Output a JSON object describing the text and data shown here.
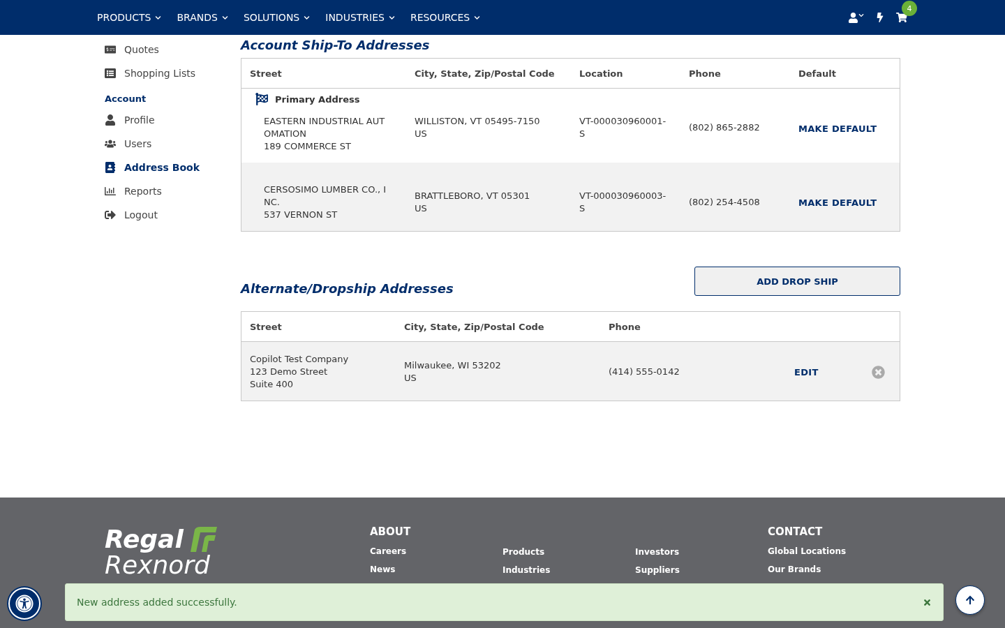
{
  "nav": {
    "menus": [
      "PRODUCTS",
      "BRANDS",
      "SOLUTIONS",
      "INDUSTRIES",
      "RESOURCES"
    ],
    "cart_count": "4"
  },
  "sidebar": {
    "groups": [
      {
        "items": [
          {
            "label": "Quotes",
            "selected": false
          },
          {
            "label": "Shopping Lists",
            "selected": false
          }
        ]
      },
      {
        "heading": "Account",
        "items": [
          {
            "label": "Profile",
            "selected": false
          },
          {
            "label": "Users",
            "selected": false
          },
          {
            "label": "Address Book",
            "selected": true
          },
          {
            "label": "Reports",
            "selected": false
          },
          {
            "label": "Logout",
            "selected": false
          }
        ]
      }
    ]
  },
  "ship_to": {
    "title": "Account Ship-To Addresses",
    "columns": [
      "Street",
      "City, State, Zip/Postal Code",
      "Location",
      "Phone",
      "Default"
    ],
    "rows": [
      {
        "primary": true,
        "primary_label": "Primary Address",
        "street": [
          "EASTERN INDUSTRIAL AUT",
          "OMATION",
          "189 COMMERCE ST"
        ],
        "city": [
          "WILLISTON, VT 05495-7150",
          "US"
        ],
        "location": [
          "VT-000030960001-",
          "S"
        ],
        "phone": "(802) 865-2882",
        "action": "MAKE DEFAULT"
      },
      {
        "primary": false,
        "street": [
          "CERSOSIMO LUMBER CO., I",
          "NC.",
          "537 VERNON ST"
        ],
        "city": [
          "BRATTLEBORO, VT 05301",
          "US"
        ],
        "location": [
          "VT-000030960003-",
          "S"
        ],
        "phone": "(802) 254-4508",
        "action": "MAKE DEFAULT"
      }
    ]
  },
  "dropship": {
    "title": "Alternate/Dropship Addresses",
    "add_button": "ADD DROP SHIP",
    "columns": [
      "Street",
      "City, State, Zip/Postal Code",
      "Phone"
    ],
    "rows": [
      {
        "street": [
          "Copilot Test Company",
          "123 Demo Street",
          "Suite 400"
        ],
        "city": [
          "Milwaukee, WI 53202",
          "US"
        ],
        "phone": "(414) 555-0142",
        "action": "EDIT"
      }
    ]
  },
  "footer": {
    "logo": [
      "Regal",
      "Rexnord"
    ],
    "about_heading": "ABOUT",
    "columns": [
      [
        "Careers",
        "News"
      ],
      [
        "Products",
        "Industries"
      ],
      [
        "Investors",
        "Suppliers"
      ]
    ],
    "contact_heading": "CONTACT",
    "contact": [
      "Global Locations",
      "Our Brands"
    ]
  },
  "toast": {
    "message": "New address added successfully."
  }
}
